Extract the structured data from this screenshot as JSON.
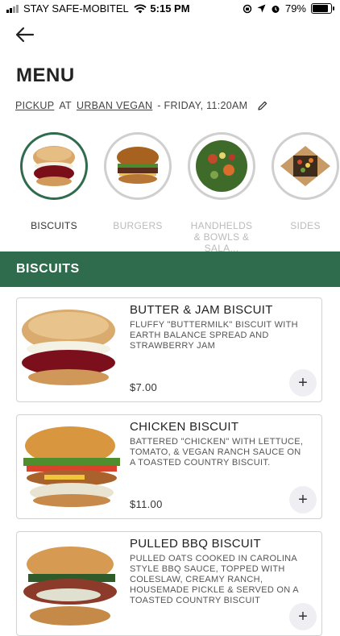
{
  "status": {
    "carrier": "STAY SAFE-MOBITEL",
    "time": "5:15 PM",
    "battery": "79%"
  },
  "page": {
    "title": "MENU",
    "order": {
      "mode": "PICKUP",
      "at": "AT",
      "location": "URBAN VEGAN",
      "when": "- FRIDAY, 11:20AM"
    }
  },
  "categories": [
    {
      "label": "BISCUITS",
      "active": true
    },
    {
      "label": "BURGERS",
      "active": false
    },
    {
      "label": "HANDHELDS & BOWLS & SALA...",
      "active": false
    },
    {
      "label": "SIDES",
      "active": false
    }
  ],
  "section": {
    "title": "BISCUITS"
  },
  "items": [
    {
      "name": "BUTTER & JAM BISCUIT",
      "description": "FLUFFY \"BUTTERMILK\" BISCUIT WITH EARTH BALANCE SPREAD AND STRAWBERRY JAM",
      "price": "$7.00",
      "add": "+"
    },
    {
      "name": "CHICKEN BISCUIT",
      "description": "BATTERED \"CHICKEN\" WITH LETTUCE, TOMATO, & VEGAN RANCH SAUCE ON A TOASTED COUNTRY BISCUIT.",
      "price": "$11.00",
      "add": "+"
    },
    {
      "name": "PULLED BBQ BISCUIT",
      "description": "PULLED OATS COOKED IN CAROLINA STYLE BBQ SAUCE, TOPPED WITH COLESLAW, CREAMY RANCH, HOUSEMADE PICKLE & SERVED ON A TOASTED COUNTRY BISCUIT",
      "price": "",
      "add": "+"
    }
  ],
  "colors": {
    "brand_green": "#2f6b4d"
  }
}
